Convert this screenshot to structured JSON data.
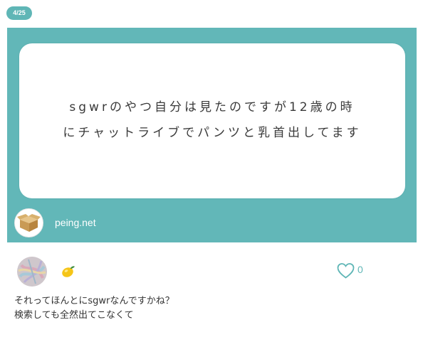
{
  "counter": "4/25",
  "question": {
    "lines": [
      "sgwrのやつ自分は見たのですが12歳の時",
      "にチャットライブでパンツと乳首出してます"
    ]
  },
  "source": {
    "label": "peing.net",
    "icon": "cardboard-box-icon"
  },
  "answer": {
    "emoji": "lemon-icon",
    "likes": "0",
    "lines": [
      "それってほんとにsgwrなんですかね？",
      "検索しても全然出てこなくて"
    ]
  },
  "colors": {
    "accent": "#62b7b8",
    "text": "#333333"
  }
}
